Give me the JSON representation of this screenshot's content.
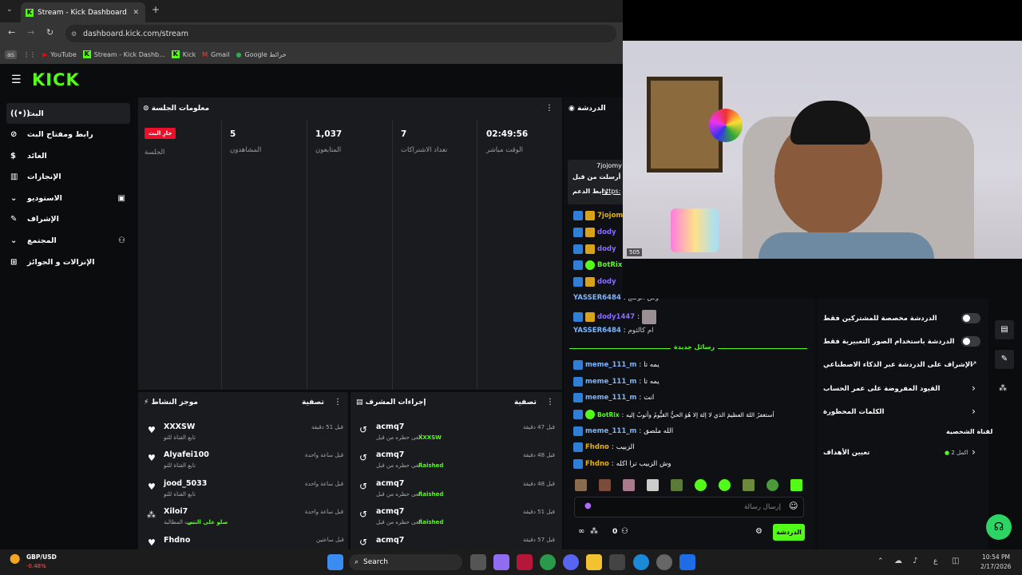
{
  "browser": {
    "tab_title": "Stream - Kick Dashboard",
    "url": "dashboard.kick.com/stream",
    "profile": "as",
    "bookmarks": [
      "YouTube",
      "Stream - Kick Dashb...",
      "Kick",
      "Gmail",
      "Google خرائط"
    ]
  },
  "logo": "KICK",
  "sidebar": {
    "items": [
      {
        "label": "البث",
        "icon": "broadcast-icon"
      },
      {
        "label": "رابط ومفتاح البث",
        "icon": "link-icon"
      },
      {
        "label": "العائد",
        "icon": "dollar-icon"
      },
      {
        "label": "الإنجازات",
        "icon": "trophy-icon"
      },
      {
        "label": "الاستوديو",
        "icon": "chevron-down-icon"
      },
      {
        "label": "الإشراف",
        "icon": "wrench-icon"
      },
      {
        "label": "المجتمع",
        "icon": "chevron-down-icon"
      },
      {
        "label": "الإنزالات و الجوائز",
        "icon": "gift-icon"
      }
    ]
  },
  "session": {
    "title": "معلومات الجلسة",
    "live_badge": "جارِ البث",
    "session_label": "الجلسة",
    "stats": [
      {
        "value": "5",
        "label": "المشاهدون"
      },
      {
        "value": "1,037",
        "label": "المتابعون"
      },
      {
        "value": "7",
        "label": "تعداد الاشتراكات"
      },
      {
        "value": "02:49:56",
        "label": "الوقت مباشر"
      }
    ]
  },
  "activity": {
    "title": "موجز النشاط",
    "filter": "تصفية",
    "items": [
      {
        "name": "XXXSW",
        "desc": "تابع القناة للتو",
        "time": "قبل 51 دقيقة"
      },
      {
        "name": "Alyafei100",
        "desc": "تابع القناة للتو",
        "time": "قبل ساعة واحدة"
      },
      {
        "name": "jood_5033",
        "desc": "تابع القناة للتو",
        "time": "قبل ساعة واحدة"
      },
      {
        "name": "Xiloi7",
        "desc": "تمت المطالبة",
        "desc2": "صلو على النبي",
        "time": "قبل ساعة واحدة"
      },
      {
        "name": "Fhdno",
        "desc": "",
        "time": "قبل ساعتين"
      }
    ]
  },
  "modactions": {
    "title": "إجراءات المشرف",
    "filter": "تصفية",
    "items": [
      {
        "name": "acmq7",
        "desc": "ألغى حظره من قبل",
        "target": "XXXSW",
        "time": "قبل 47 دقيقة"
      },
      {
        "name": "acmq7",
        "desc": "ألغى حظره من قبل",
        "target": "Raished",
        "time": "قبل 48 دقيقة"
      },
      {
        "name": "acmq7",
        "desc": "ألغى حظره من قبل",
        "target": "Raished",
        "time": "قبل 48 دقيقة"
      },
      {
        "name": "acmq7",
        "desc": "ألغى حظره من قبل",
        "target": "Raished",
        "time": "قبل 51 دقيقة"
      },
      {
        "name": "acmq7",
        "desc": "",
        "target": "",
        "time": "قبل 57 دقيقة"
      }
    ]
  },
  "chat": {
    "title": "الدردشة",
    "pinned_user": "7jojomy",
    "pinned_text": "أرسلت من قبل",
    "pinned_link_label": "رابط الدعم",
    "pinned_link": "https:",
    "messages": [
      {
        "user": "7jojomy",
        "text": "",
        "color": "gold"
      },
      {
        "user": "dody",
        "text": "",
        "color": "pur"
      },
      {
        "user": "dody",
        "text": "",
        "color": "pur"
      },
      {
        "user": "BotRix",
        "text": "",
        "color": "grn"
      },
      {
        "user": "dody",
        "text": "",
        "color": "pur"
      },
      {
        "user": "YASSER6484",
        "text": "وش الوضع",
        "color": "blue"
      },
      {
        "user": "dody1447",
        "text": "",
        "color": "pur"
      },
      {
        "user": "YASSER6484",
        "text": "ام كالثوم",
        "color": "blue"
      }
    ],
    "new_messages": "رسائل جديدة",
    "messages2": [
      {
        "user": "meme_111_m",
        "text": "يمه تا",
        "color": "blue"
      },
      {
        "user": "meme_111_m",
        "text": "يمه تا",
        "color": "blue"
      },
      {
        "user": "meme_111_m",
        "text": "انت",
        "color": "blue"
      },
      {
        "user": "BotRix",
        "text": "أستغفرُ اللهَ العظيمَ الذي لا إلهَ إلا هُوَ الحيُّ القيُّومُ وأتوبُ إليه",
        "color": "grn"
      },
      {
        "user": "meme_111_m",
        "text": "الله ملصق",
        "color": "blue"
      },
      {
        "user": "Fhdno",
        "text": "الزبيب",
        "color": "gold"
      },
      {
        "user": "Fhdno",
        "text": "وش الزبيب ترا اكله",
        "color": "gold"
      }
    ],
    "input_placeholder": "إرسال رسالة",
    "send_button": "الدردشة",
    "viewer_count": "0"
  },
  "settings": {
    "items": [
      {
        "label": "الدردشة مخصصة للمشتركين فقط",
        "type": "toggle"
      },
      {
        "label": "الدردشة باستخدام الصور التعبيرية فقط",
        "type": "toggle"
      },
      {
        "label": "الإشراف على الدردشة عبر الذكاء الاصطناعي",
        "type": "external"
      },
      {
        "label": "القيود المفروضة على عمر الحساب",
        "type": "chevron"
      },
      {
        "label": "الكلمات المحظورة",
        "type": "chevron"
      }
    ],
    "section": "القناة الشخصية",
    "goals_label": "تعيين الأهداف",
    "goals_value": "اكمل 2"
  },
  "webcam": {
    "viewers_overlay": "505"
  },
  "taskbar": {
    "ticker_pair": "GBP/USD",
    "ticker_value": "-0.48%",
    "search": "Search",
    "time": "10:54 PM",
    "date": "2/17/2026",
    "lang": "ع"
  },
  "colors": {
    "accent": "#53fc18",
    "live": "#e9112a",
    "panel": "#191b1f"
  }
}
